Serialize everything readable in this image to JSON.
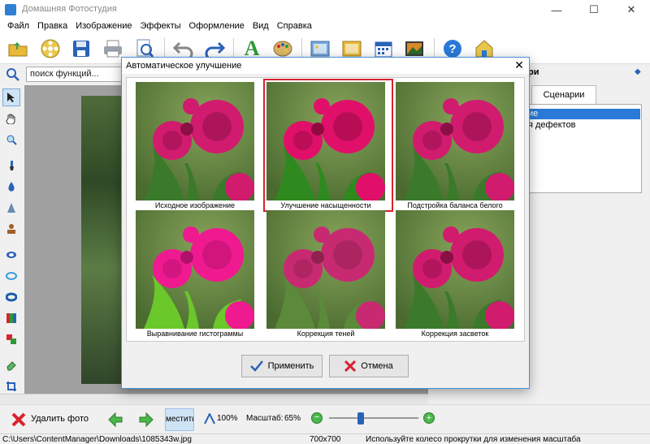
{
  "app": {
    "title": "Домашняя Фотостудия"
  },
  "menu": [
    "Файл",
    "Правка",
    "Изображение",
    "Эффекты",
    "Оформление",
    "Вид",
    "Справка"
  ],
  "toolbar": {
    "icons": [
      "open-folder-icon",
      "film-reel-icon",
      "save-icon",
      "print-icon",
      "preview-zoom-icon",
      "undo-icon",
      "redo-icon",
      "text-icon",
      "palette-icon",
      "frame-icon",
      "card-icon",
      "calendar-icon",
      "collage-icon",
      "help-icon",
      "home-icon"
    ]
  },
  "search": {
    "placeholder": "поиск функций..."
  },
  "right_panel": {
    "header_fragment": "ри",
    "tab_label": "Сценарии",
    "list_items": [
      "ие",
      "я дефектов"
    ]
  },
  "dialog": {
    "title": "Автоматическое улучшение",
    "thumbnails": [
      {
        "caption": "Исходное изображение",
        "selected": false
      },
      {
        "caption": "Улучшение насыщенности",
        "selected": true
      },
      {
        "caption": "Подстройка баланса белого",
        "selected": false
      },
      {
        "caption": "Выравнивание гистограммы",
        "selected": false
      },
      {
        "caption": "Коррекция теней",
        "selected": false
      },
      {
        "caption": "Коррекция засветок",
        "selected": false
      }
    ],
    "apply_label": "Применить",
    "cancel_label": "Отмена"
  },
  "bottom": {
    "delete_label": "Удалить фото",
    "fit_label": "местить",
    "zoom_100_label": "100%",
    "scale_label": "Масштаб:",
    "scale_value": "65%",
    "zoom_slider_fraction": 0.65
  },
  "status": {
    "path": "C:\\Users\\ContentManager\\Downloads\\1085343w.jpg",
    "dimensions": "700x700",
    "hint": "Используйте колесо прокрутки для изменения масштаба"
  },
  "colors": {
    "selection_border": "#d9232e",
    "accent": "#2f7fd3",
    "rose": "#d81b74"
  }
}
